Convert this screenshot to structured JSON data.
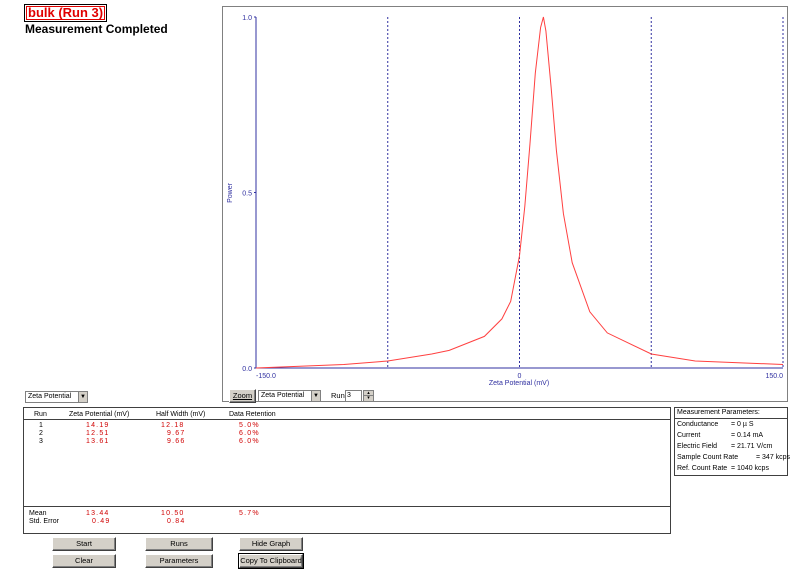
{
  "header": {
    "title": "bulk (Run 3)",
    "status": "Measurement Completed"
  },
  "graph": {
    "ylabel": "Power",
    "xlabel": "Zeta Potential (mV)",
    "y_ticks": [
      "1.0",
      "0.5",
      "0.0"
    ],
    "x_ticks": [
      "-150.0",
      "0",
      "150.0"
    ]
  },
  "chart_data": {
    "type": "line",
    "title": "",
    "xlabel": "Zeta Potential (mV)",
    "ylabel": "Power",
    "xlim": [
      -150,
      150
    ],
    "ylim": [
      0,
      1
    ],
    "series": [
      {
        "color": "#ff4040",
        "x": [
          -150,
          -100,
          -75,
          -50,
          -40,
          -30,
          -20,
          -10,
          -5,
          0,
          3,
          6,
          9,
          12,
          13.6,
          15,
          18,
          21,
          25,
          30,
          40,
          50,
          75,
          100,
          150
        ],
        "y": [
          0.0,
          0.01,
          0.02,
          0.04,
          0.05,
          0.07,
          0.09,
          0.14,
          0.19,
          0.32,
          0.46,
          0.64,
          0.84,
          0.97,
          1.0,
          0.96,
          0.8,
          0.62,
          0.44,
          0.3,
          0.16,
          0.1,
          0.04,
          0.02,
          0.01
        ]
      }
    ],
    "vertical_guides": [
      -150,
      -75,
      0,
      75,
      150
    ],
    "grid": false
  },
  "controls": {
    "zoom_label": "Zoom",
    "graph_select": "Zeta Potential",
    "run_label": "Run",
    "run_value": "3",
    "left_select": "Zeta Potential"
  },
  "results": {
    "columns": [
      "Run",
      "Zeta Potential (mV)",
      "Half Width (mV)",
      "Data Retention"
    ],
    "rows": [
      {
        "run": "1",
        "zeta": "14.19",
        "half": "12.18",
        "retention": "5.0%"
      },
      {
        "run": "2",
        "zeta": "12.51",
        "half": "9.67",
        "retention": "6.0%"
      },
      {
        "run": "3",
        "zeta": "13.61",
        "half": "9.66",
        "retention": "6.0%"
      }
    ],
    "mean": {
      "label": "Mean",
      "zeta": "13.44",
      "half": "10.50",
      "retention": "5.7%"
    },
    "stderr": {
      "label": "Std. Error",
      "zeta": "0.49",
      "half": "0.84"
    }
  },
  "params": {
    "title": "Measurement Parameters:",
    "items": [
      {
        "label": "Conductance",
        "value": "= 0 µ S"
      },
      {
        "label": "Current",
        "value": "= 0.14 mA"
      },
      {
        "label": "Electric Field",
        "value": "= 21.71 V/cm"
      },
      {
        "label": "Sample Count Rate",
        "value": "= 347 kcps"
      },
      {
        "label": "Ref. Count Rate",
        "value": "= 1040 kcps"
      }
    ]
  },
  "buttons": {
    "start": "Start",
    "clear": "Clear",
    "runs": "Runs",
    "parameters": "Parameters",
    "hide_graph": "Hide Graph",
    "copy": "Copy To Clipboard"
  }
}
